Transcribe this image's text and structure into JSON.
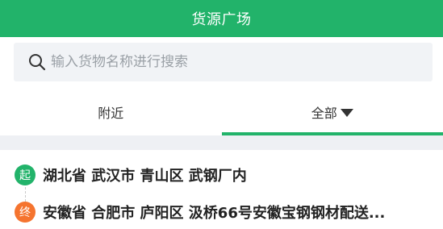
{
  "header": {
    "title": "货源广场",
    "background_color": "#22b36a"
  },
  "search": {
    "placeholder": "输入货物名称进行搜索",
    "value": ""
  },
  "tabs": [
    {
      "label": "附近",
      "active": false
    },
    {
      "label": "全部",
      "active": true,
      "has_dropdown": true
    }
  ],
  "listing": {
    "start_badge": "起",
    "start_address": "湖北省 武汉市 青山区 武钢厂内",
    "end_badge": "终",
    "end_address": "安徽省 合肥市 庐阳区 汲桥66号安徽宝钢钢材配送...",
    "start_color": "#22b36a",
    "end_color": "#f5742f"
  },
  "icons": {
    "search": "search-icon",
    "dropdown": "caret-down-icon"
  }
}
